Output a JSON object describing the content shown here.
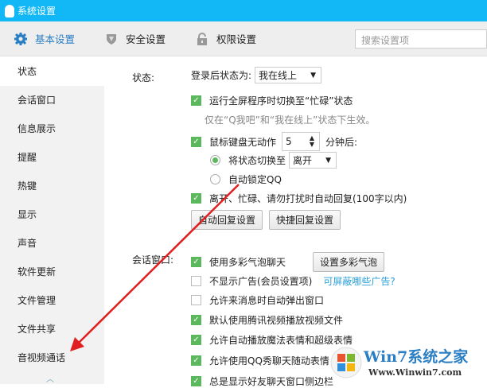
{
  "window": {
    "title": "系统设置"
  },
  "tabs": [
    {
      "label": "基本设置",
      "icon": "gear-icon"
    },
    {
      "label": "安全设置",
      "icon": "shield-icon"
    },
    {
      "label": "权限设置",
      "icon": "lock-icon"
    }
  ],
  "search": {
    "placeholder": "搜索设置项"
  },
  "sidebar": {
    "items": [
      "状态",
      "会话窗口",
      "信息展示",
      "提醒",
      "热键",
      "显示",
      "声音",
      "软件更新",
      "文件管理",
      "文件共享",
      "音视频通话"
    ]
  },
  "status": {
    "section_label": "状态:",
    "login_status_label": "登录后状态为:",
    "login_status_value": "我在线上",
    "fullscreen_busy": "运行全屏程序时切换至“忙碌”状态",
    "fullscreen_hint": "仅在“Q我吧”和“我在线上”状态下生效。",
    "idle_label": "鼠标键盘无动作",
    "idle_minutes": "5",
    "idle_suffix": "分钟后:",
    "switch_status_label": "将状态切换至",
    "switch_status_value": "离开",
    "auto_lock": "自动锁定QQ",
    "auto_reply": "离开、忙碌、请勿打扰时自动回复(100字以内)",
    "auto_reply_btn": "自动回复设置",
    "quick_reply_btn": "快捷回复设置"
  },
  "chat": {
    "section_label": "会话窗口:",
    "items": [
      {
        "label": "使用多彩气泡聊天",
        "checked": true
      },
      {
        "label": "不显示广告(会员设置项)",
        "checked": false
      },
      {
        "label": "允许来消息时自动弹出窗口",
        "checked": false
      },
      {
        "label": "默认使用腾讯视频播放视频文件",
        "checked": true
      },
      {
        "label": "允许自动播放魔法表情和超级表情",
        "checked": true
      },
      {
        "label": "允许使用QQ秀聊天随动表情",
        "checked": true
      },
      {
        "label": "总是显示好友聊天窗口侧边栏",
        "checked": true
      }
    ],
    "bubble_btn": "设置多彩气泡",
    "ads_link": "可屏蔽哪些广告?"
  },
  "watermark": {
    "title": "Win7系统之家",
    "url": "Www.Winwin7.com"
  },
  "colors": {
    "titlebar": "#12b7f5",
    "accent": "#2a7ec4",
    "check": "#5cb85c",
    "arrow": "#e02020"
  }
}
